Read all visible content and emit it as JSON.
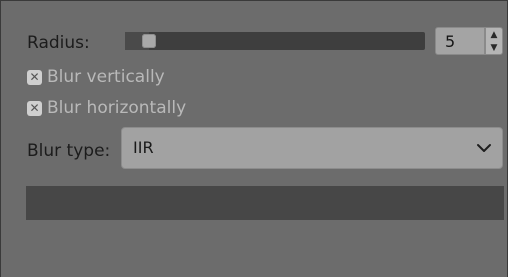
{
  "radius": {
    "label": "Radius:",
    "value": "5",
    "slider_fraction": 0.06
  },
  "options": {
    "blur_vertically": {
      "label": "Blur vertically",
      "checked": true
    },
    "blur_horizontally": {
      "label": "Blur horizontally",
      "checked": true
    }
  },
  "blur_type": {
    "label": "Blur type:",
    "selected": "IIR"
  },
  "icons": {
    "check": "x-check-icon",
    "spin_up": "triangle-up-icon",
    "spin_down": "triangle-down-icon",
    "dropdown": "chevron-down-icon"
  },
  "colors": {
    "background": "#6c6c6c",
    "track": "#3e3e3e",
    "field": "#a2a2a2"
  }
}
